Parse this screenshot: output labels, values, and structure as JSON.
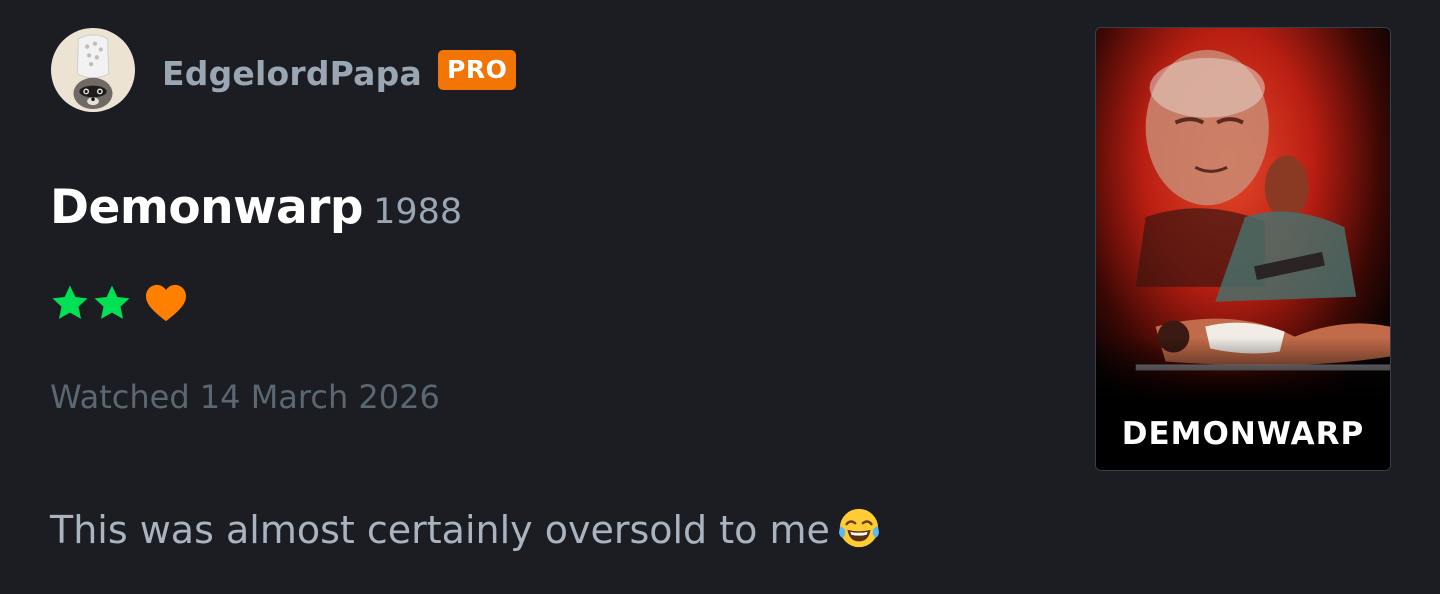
{
  "review": {
    "user": {
      "username": "EdgelordPapa",
      "badge": "PRO",
      "avatar_icon": "raccoon-crocs-avatar"
    },
    "film": {
      "title": "Demonwarp",
      "year": "1988",
      "poster_title": "DEMONWARP"
    },
    "rating": {
      "stars": 2,
      "max_stars": 5,
      "liked": true,
      "star_color": "#00e054",
      "like_color": "#ff8000"
    },
    "watched_text": "Watched 14 March 2026",
    "body": "This was almost certainly oversold to me",
    "body_emoji": "😂",
    "colors": {
      "background": "#1b1d22",
      "badge": "#f27405",
      "username": "#9aa6b3",
      "muted": "#5c6774"
    }
  }
}
